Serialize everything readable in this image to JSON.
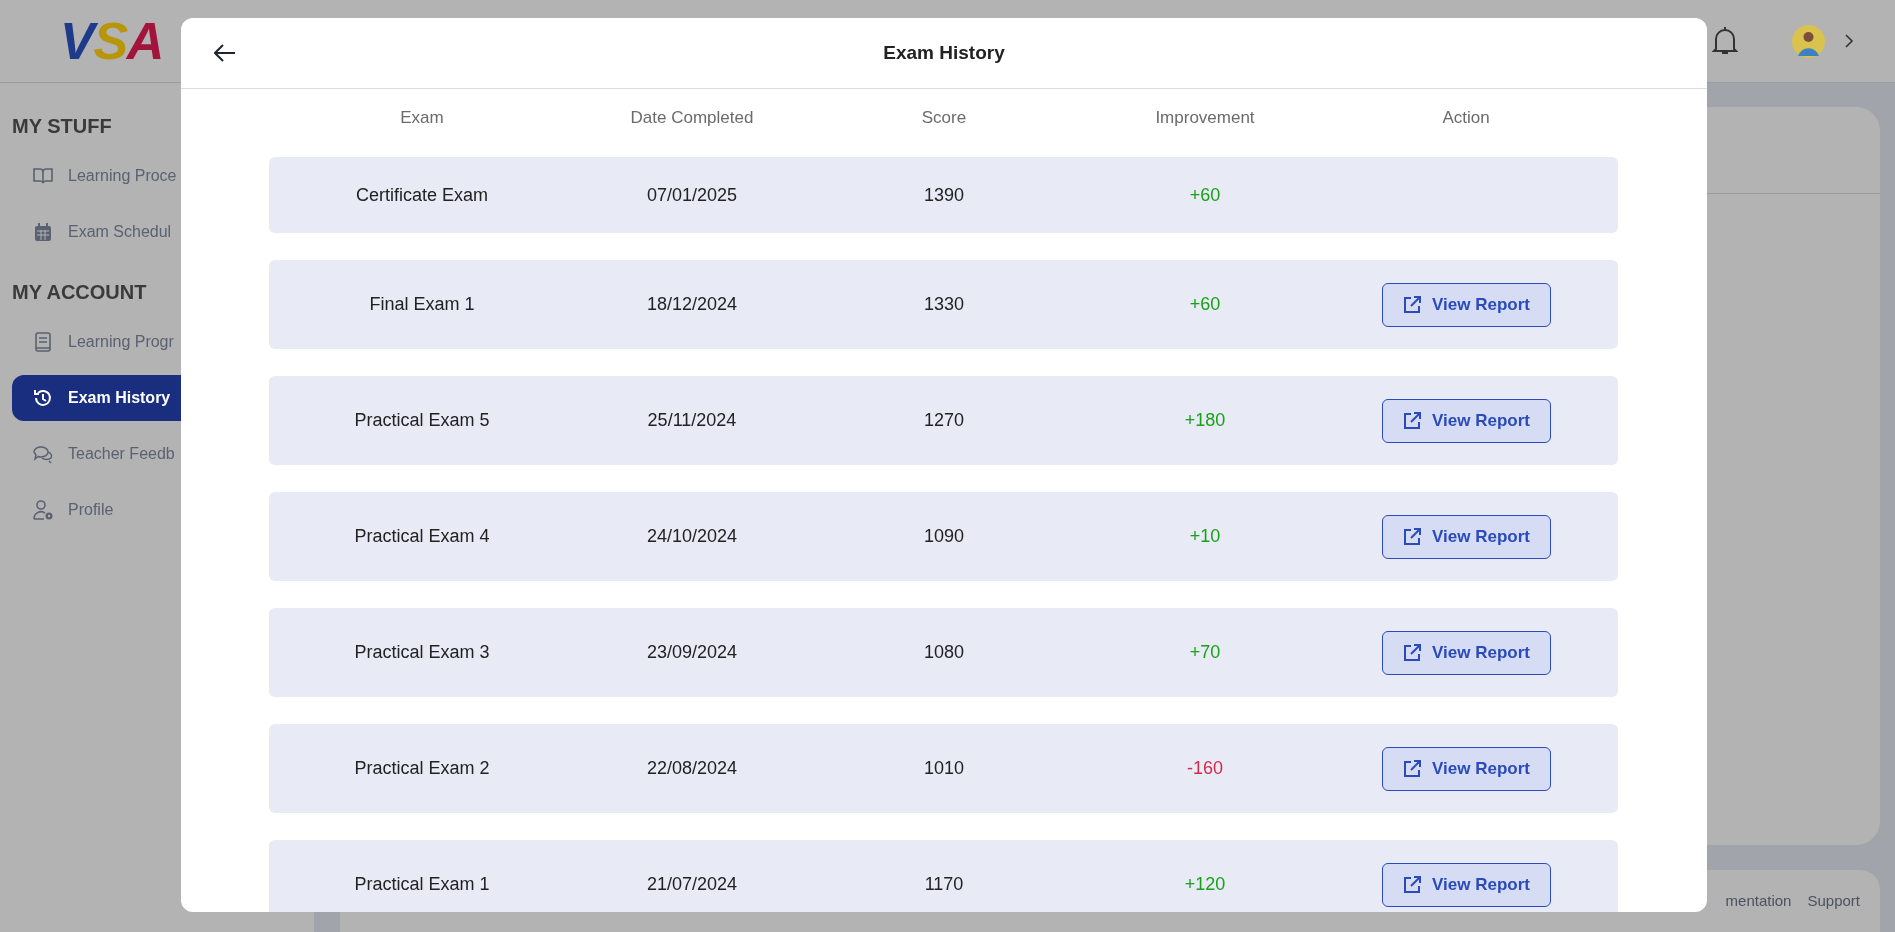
{
  "logo": {
    "letters": [
      {
        "text": "V",
        "color": "#1e3a8a"
      },
      {
        "text": "S",
        "color": "#b8960c"
      },
      {
        "text": "A",
        "color": "#a3143c"
      }
    ]
  },
  "sidebar": {
    "sections": [
      {
        "title": "MY STUFF",
        "items": [
          {
            "label": "Learning Proce",
            "kind": "book",
            "selected": false
          },
          {
            "label": "Exam Schedul",
            "kind": "calendar",
            "selected": false
          }
        ]
      },
      {
        "title": "MY ACCOUNT",
        "items": [
          {
            "label": "Learning Progr",
            "kind": "notebook",
            "selected": false
          },
          {
            "label": "Exam History",
            "kind": "history",
            "selected": true
          },
          {
            "label": "Teacher Feedb",
            "kind": "chat",
            "selected": false
          },
          {
            "label": "Profile",
            "kind": "user-gear",
            "selected": false
          }
        ]
      }
    ]
  },
  "footer": {
    "links": [
      "mentation",
      "Support"
    ]
  },
  "modal": {
    "title": "Exam History",
    "table": {
      "columns": [
        "Exam",
        "Date Completed",
        "Score",
        "Improvement",
        "Action"
      ],
      "rows": [
        {
          "exam": "Certificate Exam",
          "date": "07/01/2025",
          "score": "1390",
          "improvement": "+60",
          "color": "#16a316"
        },
        {
          "exam": "Final Exam 1",
          "date": "18/12/2024",
          "score": "1330",
          "improvement": "+60",
          "color": "#16a316",
          "action": "View Report"
        },
        {
          "exam": "Practical Exam 5",
          "date": "25/11/2024",
          "score": "1270",
          "improvement": "+180",
          "color": "#16a316",
          "action": "View Report"
        },
        {
          "exam": "Practical Exam 4",
          "date": "24/10/2024",
          "score": "1090",
          "improvement": "+10",
          "color": "#16a316",
          "action": "View Report"
        },
        {
          "exam": "Practical Exam 3",
          "date": "23/09/2024",
          "score": "1080",
          "improvement": "+70",
          "color": "#16a316",
          "action": "View Report"
        },
        {
          "exam": "Practical Exam 2",
          "date": "22/08/2024",
          "score": "1010",
          "improvement": "-160",
          "color": "#d42a4a",
          "action": "View Report"
        },
        {
          "exam": "Practical Exam 1",
          "date": "21/07/2024",
          "score": "1170",
          "improvement": "+120",
          "color": "#16a316",
          "action": "View Report"
        }
      ]
    }
  }
}
